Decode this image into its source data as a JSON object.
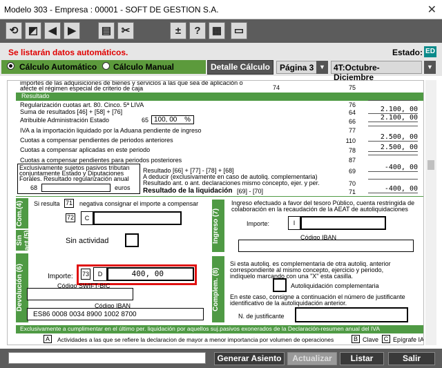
{
  "window": {
    "title": "Modelo 303 - Empresa : 00001 - SOFT DE GESTION S.A."
  },
  "toolbar": {
    "icons": [
      "refresh-icon",
      "clear-icon",
      "prev-icon",
      "next-icon",
      "print-icon",
      "tools-icon",
      "plus-minus-icon",
      "help-icon",
      "calculator-icon",
      "minus-icon"
    ],
    "plusminus": "±",
    "help": "?"
  },
  "header": {
    "warning": "Se listarán datos automáticos.",
    "estado_label": "Estado:",
    "estado_value": "ED",
    "calc_auto": "Cálculo Automático",
    "calc_manual": "Cálculo Manual",
    "detalle_button": "Detalle Cálculo",
    "page_value": "Página 3",
    "period_value": "4T:Octubre-Diciembre"
  },
  "form": {
    "top_line1": "importes de las adquisiciones de bienes y servicios a las que sea de aplicación o",
    "top_line2": "afecte el régimen especial de criterio de caja",
    "top_box1": "74",
    "top_box2": "75",
    "resultado_header": "Resultado",
    "rows": [
      {
        "label": "Regularización cuotas art. 80. Cinco. 5ª LIVA",
        "box": "76",
        "value": ""
      },
      {
        "label": "Suma de resultados [46] + [58] + [76]",
        "box": "64",
        "value": "2.100, 00"
      },
      {
        "label": "Atribuible Administración Estado",
        "box": "66",
        "value": "2.100, 00"
      },
      {
        "label": "IVA a la importación liquidado por la Aduana pendiente de ingreso",
        "box": "77",
        "value": ""
      },
      {
        "label": "Cuotas a compensar pendientes de periodos anteriores",
        "box": "110",
        "value": "2.500, 00"
      },
      {
        "label": "Cuotas a compensar aplicadas en este periodo",
        "box": "78",
        "value": "2.500, 00"
      },
      {
        "label": "Cuotas a compensar pendientes para periodos posteriores",
        "box": "87",
        "value": ""
      }
    ],
    "atribuible_box": "65",
    "atribuible_pct": "100, 00",
    "pct_sign": "%",
    "excl_text1": "Exclusivamente sujetos pasivos tributan",
    "excl_text2": "conjuntamente Estado y Diputaciones",
    "excl_text3": "Forales. Resultado regularización anual",
    "excl_box": "68",
    "euros": "euros",
    "res_line1": "Resultado [66] + [77] - [78] + [68]",
    "res_line1_box": "69",
    "res_line1_value": "-400, 00",
    "res_line2": "A deducir (exclusivamente en caso de autoliq. complementaria)",
    "res_line3": "Resultado ant. o ant. declaraciones mismo concepto, ejer. y per.",
    "res_line3_box": "70",
    "res_liq": "Resultado de la liquidación",
    "res_liq_formula": "[69] - [70]",
    "res_liq_box": "71",
    "res_liq_value": "-400, 00"
  },
  "comp": {
    "tab": "Com.(4)",
    "text1": "Si resulta",
    "box71": "71",
    "text2": "negativa consignar el importe a compensar",
    "box72": "72",
    "c": "C"
  },
  "sinact": {
    "tab": "Sin act.(5)",
    "text": "Sin actividad"
  },
  "devol": {
    "tab": "Devolución (6)",
    "importe": "Importe:",
    "box73": "73",
    "d": "D",
    "value": "400, 00",
    "swift": "Código SWIFT-BIC",
    "iban_label": "Código IBAN",
    "iban_value": "ES86 0008 0034 8900 1002 8700"
  },
  "ingreso": {
    "tab": "Ingreso (7)",
    "text1": "Ingreso efectuado a favor del tesoro Público, cuenta restringida de",
    "text2": "colaboración en la recaudación de la AEAT de autoliquidaciones",
    "importe": "Importe:",
    "i": "I",
    "iban_label": "Código IBAN"
  },
  "complem": {
    "tab": "Complem. (8)",
    "text1": "Si esta autoliq. es complementaria de otra autoliq. anterior",
    "text2": "correspondiente al mismo concepto, ejercicio y periodo,",
    "text3": "indíquelo marcando con una \"X\" esta casilla.",
    "check_label": "Autoliquidación complementaria",
    "text4": "En este caso, consigne a continuación el número de justificante",
    "text5": "identificativo de la autoliquidación anterior.",
    "just_label": "N. de justificante"
  },
  "footer_form": {
    "band": "Exclusivamente a cumplimentar en el último per. liquidación por aquellos suj.pasivos exonerados de la Declaración-resumen anual del IVA",
    "a": "A",
    "activity": "Actividades a las que se refiere la declaracion de mayor a menor importancia por volumen de operaciones",
    "b": "B",
    "clave": "Clave",
    "c": "C",
    "epigrafe": "Epígrafe IAE"
  },
  "bottom": {
    "generar": "Generar Asiento",
    "actualizar": "Actualizar",
    "listar": "Listar",
    "salir": "Salir",
    "status_value": ""
  }
}
